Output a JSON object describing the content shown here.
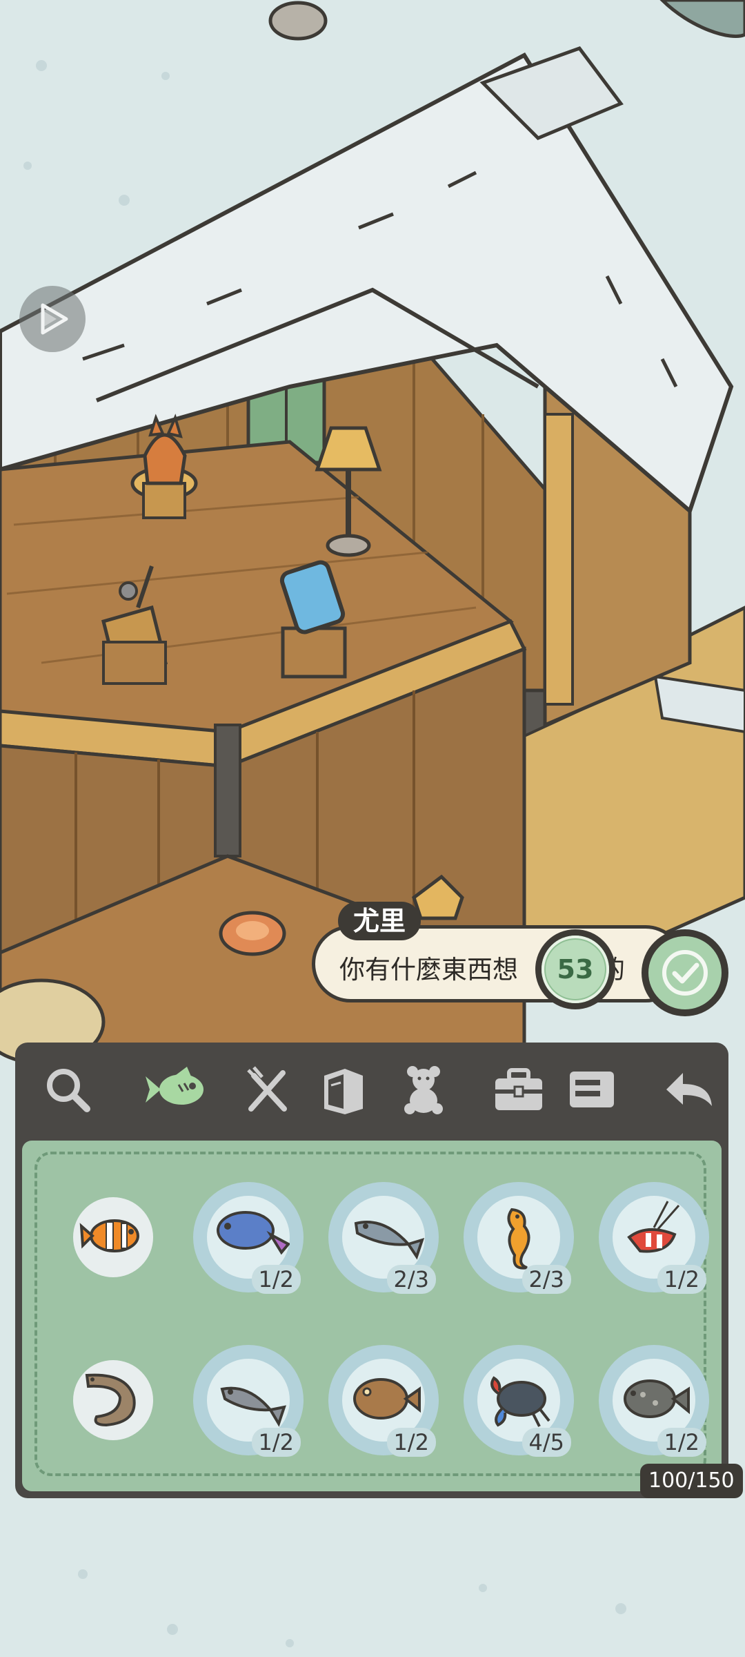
{
  "dialog": {
    "speaker": "尤里",
    "message": "你有什麼東西想",
    "message_tail": "的",
    "price": "53"
  },
  "toolbar": {
    "tabs": [
      {
        "icon": "magnifier-icon",
        "active": false
      },
      {
        "icon": "fish-icon",
        "active": true
      },
      {
        "icon": "fork-knife-icon",
        "active": false
      },
      {
        "icon": "book-icon",
        "active": false
      },
      {
        "icon": "teddy-bear-icon",
        "active": false
      },
      {
        "icon": "toolbox-icon",
        "active": false
      },
      {
        "icon": "ticket-icon",
        "active": false
      }
    ],
    "back_icon": "back-arrow-icon"
  },
  "inventory": {
    "items": [
      {
        "name": "clownfish",
        "count": ""
      },
      {
        "name": "blue-fish",
        "count": "1/2"
      },
      {
        "name": "mackerel",
        "count": "2/3"
      },
      {
        "name": "seahorse",
        "count": "2/3"
      },
      {
        "name": "shrimp",
        "count": "1/2"
      },
      {
        "name": "eel",
        "count": ""
      },
      {
        "name": "silver-fish",
        "count": "1/2"
      },
      {
        "name": "brown-fish",
        "count": "1/2"
      },
      {
        "name": "crab",
        "count": "4/5"
      },
      {
        "name": "spotted-fish",
        "count": "1/2"
      }
    ],
    "capacity": "100/150"
  },
  "colors": {
    "panel": "#4a4845",
    "grid": "#9ec3a5",
    "accent_green": "#a8d1ac"
  }
}
